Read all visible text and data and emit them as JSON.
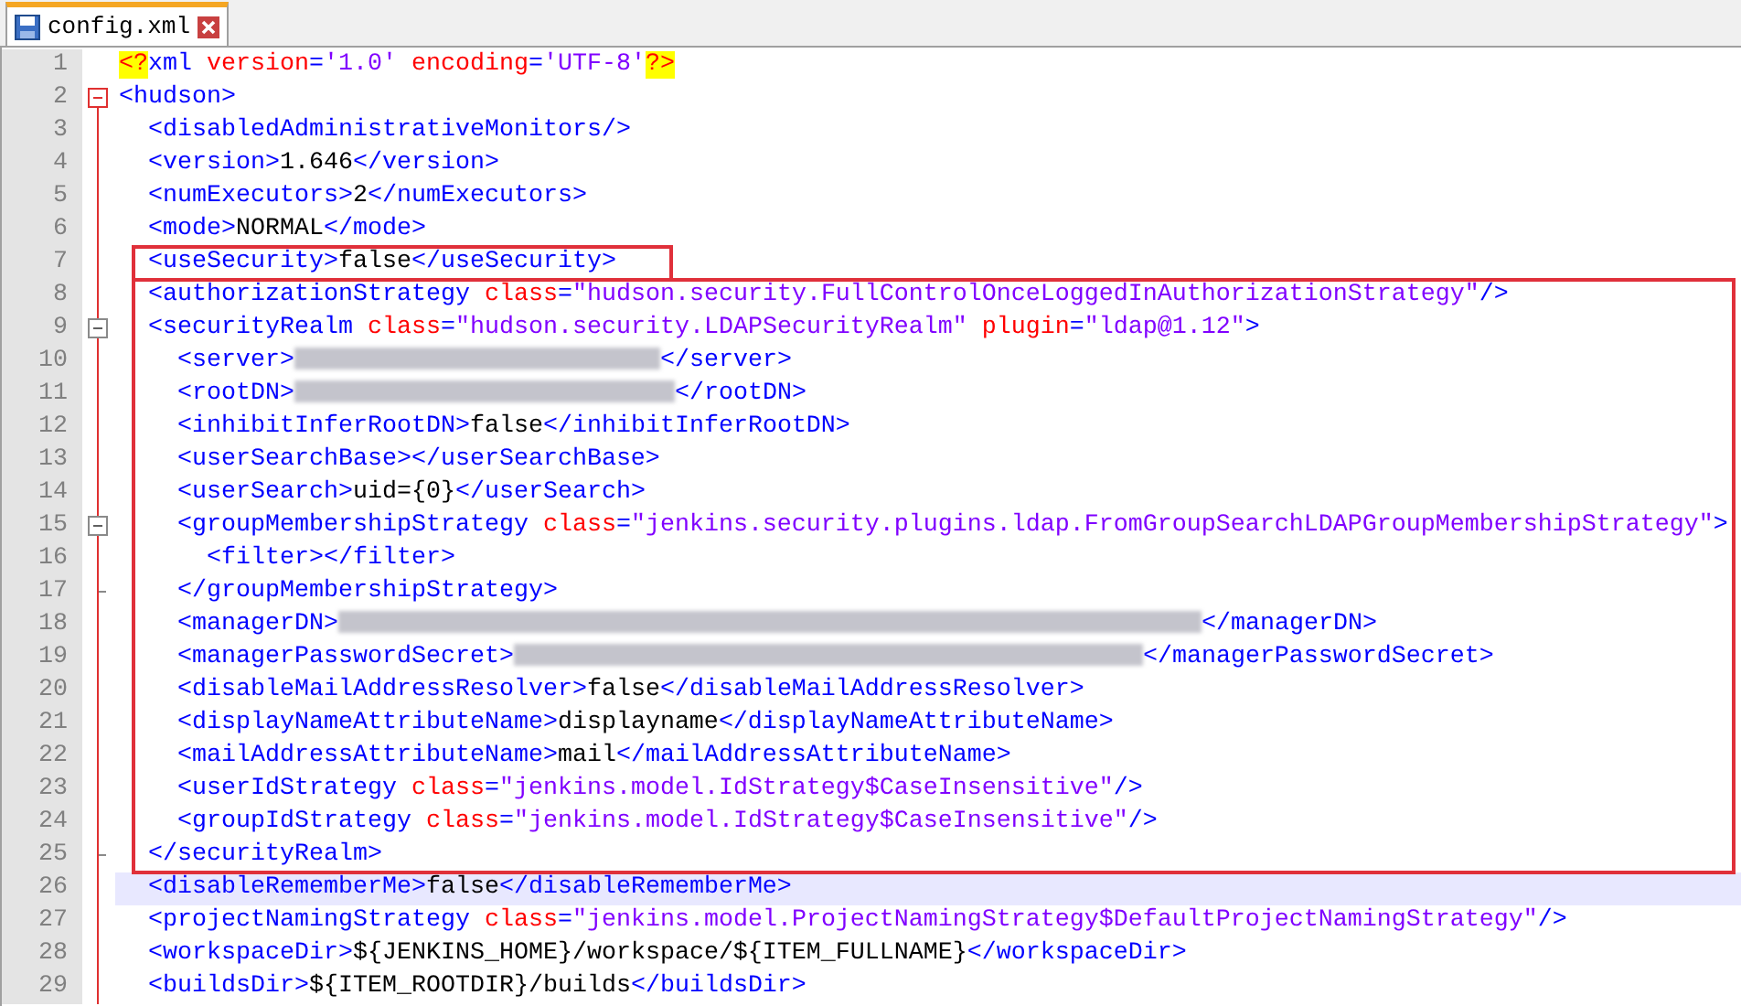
{
  "tabs": [
    {
      "label": "config.xml",
      "selected": true
    }
  ],
  "lines": [
    {
      "number": "1",
      "tokens": [
        {
          "kind": "decl",
          "text": "<?"
        },
        {
          "kind": "tag",
          "text": "xml"
        },
        {
          "kind": "attr",
          "text": " version"
        },
        {
          "kind": "tag",
          "text": "="
        },
        {
          "kind": "value",
          "text": "'1.0'"
        },
        {
          "kind": "attr",
          "text": " encoding"
        },
        {
          "kind": "tag",
          "text": "="
        },
        {
          "kind": "value",
          "text": "'UTF-8'"
        },
        {
          "kind": "decl",
          "text": "?>"
        }
      ]
    },
    {
      "number": "2",
      "fold_start": true,
      "active": true,
      "tokens": [
        {
          "kind": "tag",
          "text": "<hudson>"
        }
      ]
    },
    {
      "number": "3",
      "tokens": [
        {
          "kind": "tag",
          "text": "  <disabledAdministrativeMonitors/>"
        }
      ]
    },
    {
      "number": "4",
      "tokens": [
        {
          "kind": "tag",
          "text": "  <version>"
        },
        {
          "kind": "text",
          "text": "1.646"
        },
        {
          "kind": "tag",
          "text": "</version>"
        }
      ]
    },
    {
      "number": "5",
      "tokens": [
        {
          "kind": "tag",
          "text": "  <numExecutors>"
        },
        {
          "kind": "text",
          "text": "2"
        },
        {
          "kind": "tag",
          "text": "</numExecutors>"
        }
      ]
    },
    {
      "number": "6",
      "tokens": [
        {
          "kind": "tag",
          "text": "  <mode>"
        },
        {
          "kind": "text",
          "text": "NORMAL"
        },
        {
          "kind": "tag",
          "text": "</mode>"
        }
      ]
    },
    {
      "number": "7",
      "box_start": true,
      "box_end": true,
      "tokens": [
        {
          "kind": "tag",
          "text": "  <useSecurity>"
        },
        {
          "kind": "text",
          "text": "false"
        },
        {
          "kind": "tag",
          "text": "</useSecurity>"
        }
      ]
    },
    {
      "number": "8",
      "box_start": true,
      "tokens": [
        {
          "kind": "tag",
          "text": "  <authorizationStrategy"
        },
        {
          "kind": "attr",
          "text": " class"
        },
        {
          "kind": "tag",
          "text": "="
        },
        {
          "kind": "value",
          "text": "\"hudson.security.FullControlOnceLoggedInAuthorizationStrategy\""
        },
        {
          "kind": "tag",
          "text": "/>"
        }
      ]
    },
    {
      "number": "9",
      "fold_start": true,
      "active": false,
      "tokens": [
        {
          "kind": "tag",
          "text": "  <securityRealm"
        },
        {
          "kind": "attr",
          "text": " class"
        },
        {
          "kind": "tag",
          "text": "="
        },
        {
          "kind": "value",
          "text": "\"hudson.security.LDAPSecurityRealm\""
        },
        {
          "kind": "attr",
          "text": " plugin"
        },
        {
          "kind": "tag",
          "text": "="
        },
        {
          "kind": "value",
          "text": "\"ldap@1.12\""
        },
        {
          "kind": "tag",
          "text": ">"
        }
      ]
    },
    {
      "number": "10",
      "tokens": [
        {
          "kind": "tag",
          "text": "    <server>"
        },
        {
          "kind": "redacted-short"
        },
        {
          "kind": "tag",
          "text": "</server>"
        }
      ]
    },
    {
      "number": "11",
      "tokens": [
        {
          "kind": "tag",
          "text": "    <rootDN>"
        },
        {
          "kind": "redacted-medium"
        },
        {
          "kind": "tag",
          "text": "</rootDN>"
        }
      ]
    },
    {
      "number": "12",
      "tokens": [
        {
          "kind": "tag",
          "text": "    <inhibitInferRootDN>"
        },
        {
          "kind": "text",
          "text": "false"
        },
        {
          "kind": "tag",
          "text": "</inhibitInferRootDN>"
        }
      ]
    },
    {
      "number": "13",
      "tokens": [
        {
          "kind": "tag",
          "text": "    <userSearchBase></userSearchBase>"
        }
      ]
    },
    {
      "number": "14",
      "tokens": [
        {
          "kind": "tag",
          "text": "    <userSearch>"
        },
        {
          "kind": "text",
          "text": "uid={0}"
        },
        {
          "kind": "tag",
          "text": "</userSearch>"
        }
      ]
    },
    {
      "number": "15",
      "fold_start": true,
      "active": false,
      "tokens": [
        {
          "kind": "tag",
          "text": "    <groupMembershipStrategy"
        },
        {
          "kind": "attr",
          "text": " class"
        },
        {
          "kind": "tag",
          "text": "="
        },
        {
          "kind": "value",
          "text": "\"jenkins.security.plugins.ldap.FromGroupSearchLDAPGroupMembershipStrategy\""
        },
        {
          "kind": "tag",
          "text": ">"
        }
      ]
    },
    {
      "number": "16",
      "tokens": [
        {
          "kind": "tag",
          "text": "      <filter></filter>"
        }
      ]
    },
    {
      "number": "17",
      "fold_end": true,
      "tokens": [
        {
          "kind": "tag",
          "text": "    </groupMembershipStrategy>"
        }
      ]
    },
    {
      "number": "18",
      "tokens": [
        {
          "kind": "tag",
          "text": "    <managerDN>"
        },
        {
          "kind": "redacted-longest"
        },
        {
          "kind": "tag",
          "text": "</managerDN>"
        }
      ]
    },
    {
      "number": "19",
      "tokens": [
        {
          "kind": "tag",
          "text": "    <managerPasswordSecret>"
        },
        {
          "kind": "redacted-long"
        },
        {
          "kind": "tag",
          "text": "</managerPasswordSecret>"
        }
      ]
    },
    {
      "number": "20",
      "tokens": [
        {
          "kind": "tag",
          "text": "    <disableMailAddressResolver>"
        },
        {
          "kind": "text",
          "text": "false"
        },
        {
          "kind": "tag",
          "text": "</disableMailAddressResolver>"
        }
      ]
    },
    {
      "number": "21",
      "tokens": [
        {
          "kind": "tag",
          "text": "    <displayNameAttributeName>"
        },
        {
          "kind": "text",
          "text": "displayname"
        },
        {
          "kind": "tag",
          "text": "</displayNameAttributeName>"
        }
      ]
    },
    {
      "number": "22",
      "tokens": [
        {
          "kind": "tag",
          "text": "    <mailAddressAttributeName>"
        },
        {
          "kind": "text",
          "text": "mail"
        },
        {
          "kind": "tag",
          "text": "</mailAddressAttributeName>"
        }
      ]
    },
    {
      "number": "23",
      "tokens": [
        {
          "kind": "tag",
          "text": "    <userIdStrategy"
        },
        {
          "kind": "attr",
          "text": " class"
        },
        {
          "kind": "tag",
          "text": "="
        },
        {
          "kind": "value",
          "text": "\"jenkins.model.IdStrategy$CaseInsensitive\""
        },
        {
          "kind": "tag",
          "text": "/>"
        }
      ]
    },
    {
      "number": "24",
      "tokens": [
        {
          "kind": "tag",
          "text": "    <groupIdStrategy"
        },
        {
          "kind": "attr",
          "text": " class"
        },
        {
          "kind": "tag",
          "text": "="
        },
        {
          "kind": "value",
          "text": "\"jenkins.model.IdStrategy$CaseInsensitive\""
        },
        {
          "kind": "tag",
          "text": "/>"
        }
      ]
    },
    {
      "number": "25",
      "fold_end": true,
      "box_end": true,
      "tokens": [
        {
          "kind": "tag",
          "text": "  </securityRealm>"
        }
      ]
    },
    {
      "number": "26",
      "current": true,
      "tokens": [
        {
          "kind": "tag",
          "text": "  <disableRememberMe>"
        },
        {
          "kind": "text",
          "text": "false"
        },
        {
          "kind": "tag",
          "text": "</disableRememberMe>"
        }
      ]
    },
    {
      "number": "27",
      "tokens": [
        {
          "kind": "tag",
          "text": "  <projectNamingStrategy"
        },
        {
          "kind": "attr",
          "text": " class"
        },
        {
          "kind": "tag",
          "text": "="
        },
        {
          "kind": "value",
          "text": "\"jenkins.model.ProjectNamingStrategy$DefaultProjectNamingStrategy\""
        },
        {
          "kind": "tag",
          "text": "/>"
        }
      ]
    },
    {
      "number": "28",
      "tokens": [
        {
          "kind": "tag",
          "text": "  <workspaceDir>"
        },
        {
          "kind": "text",
          "text": "${JENKINS_HOME}/workspace/${ITEM_FULLNAME}"
        },
        {
          "kind": "tag",
          "text": "</workspaceDir>"
        }
      ]
    },
    {
      "number": "29",
      "tokens": [
        {
          "kind": "tag",
          "text": "  <buildsDir>"
        },
        {
          "kind": "text",
          "text": "${ITEM_ROOTDIR}/builds"
        },
        {
          "kind": "tag",
          "text": "</buildsDir>"
        }
      ]
    }
  ]
}
